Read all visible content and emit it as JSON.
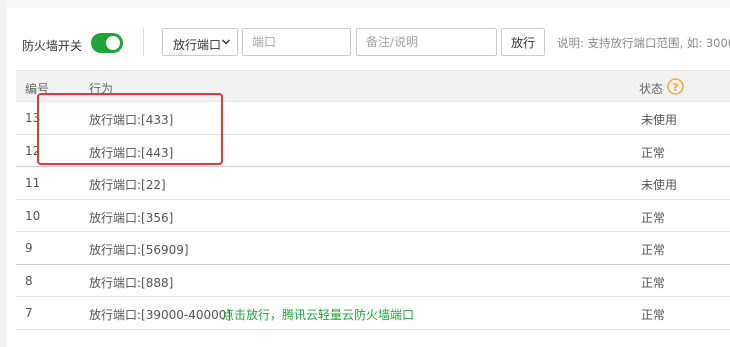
{
  "toolbar": {
    "firewall_label": "防火墙开关",
    "firewall_enabled": true,
    "select_value": "放行端口",
    "port_placeholder": "端口",
    "note_placeholder": "备注/说明",
    "submit_label": "放行",
    "hint": "说明: 支持放行端口范围, 如: 3000"
  },
  "table": {
    "headers": {
      "id": "编号",
      "action": "行为",
      "status": "状态"
    },
    "rows": [
      {
        "id": "13",
        "action": "放行端口:[433]",
        "status": "未使用"
      },
      {
        "id": "12",
        "action": "放行端口:[443]",
        "status": "正常"
      },
      {
        "id": "11",
        "action": "放行端口:[22]",
        "status": "未使用"
      },
      {
        "id": "10",
        "action": "放行端口:[356]",
        "status": "正常"
      },
      {
        "id": "9",
        "action": "放行端口:[56909]",
        "status": "正常"
      },
      {
        "id": "8",
        "action": "放行端口:[888]",
        "status": "正常"
      },
      {
        "id": "7",
        "action": "放行端口:[39000-40000]",
        "extra": "点击放行，腾讯云轻量云防火墙端口",
        "status": "正常"
      }
    ]
  },
  "colors": {
    "accent": "#20a53a",
    "annotation": "#e53935",
    "help": "#f0a020"
  }
}
